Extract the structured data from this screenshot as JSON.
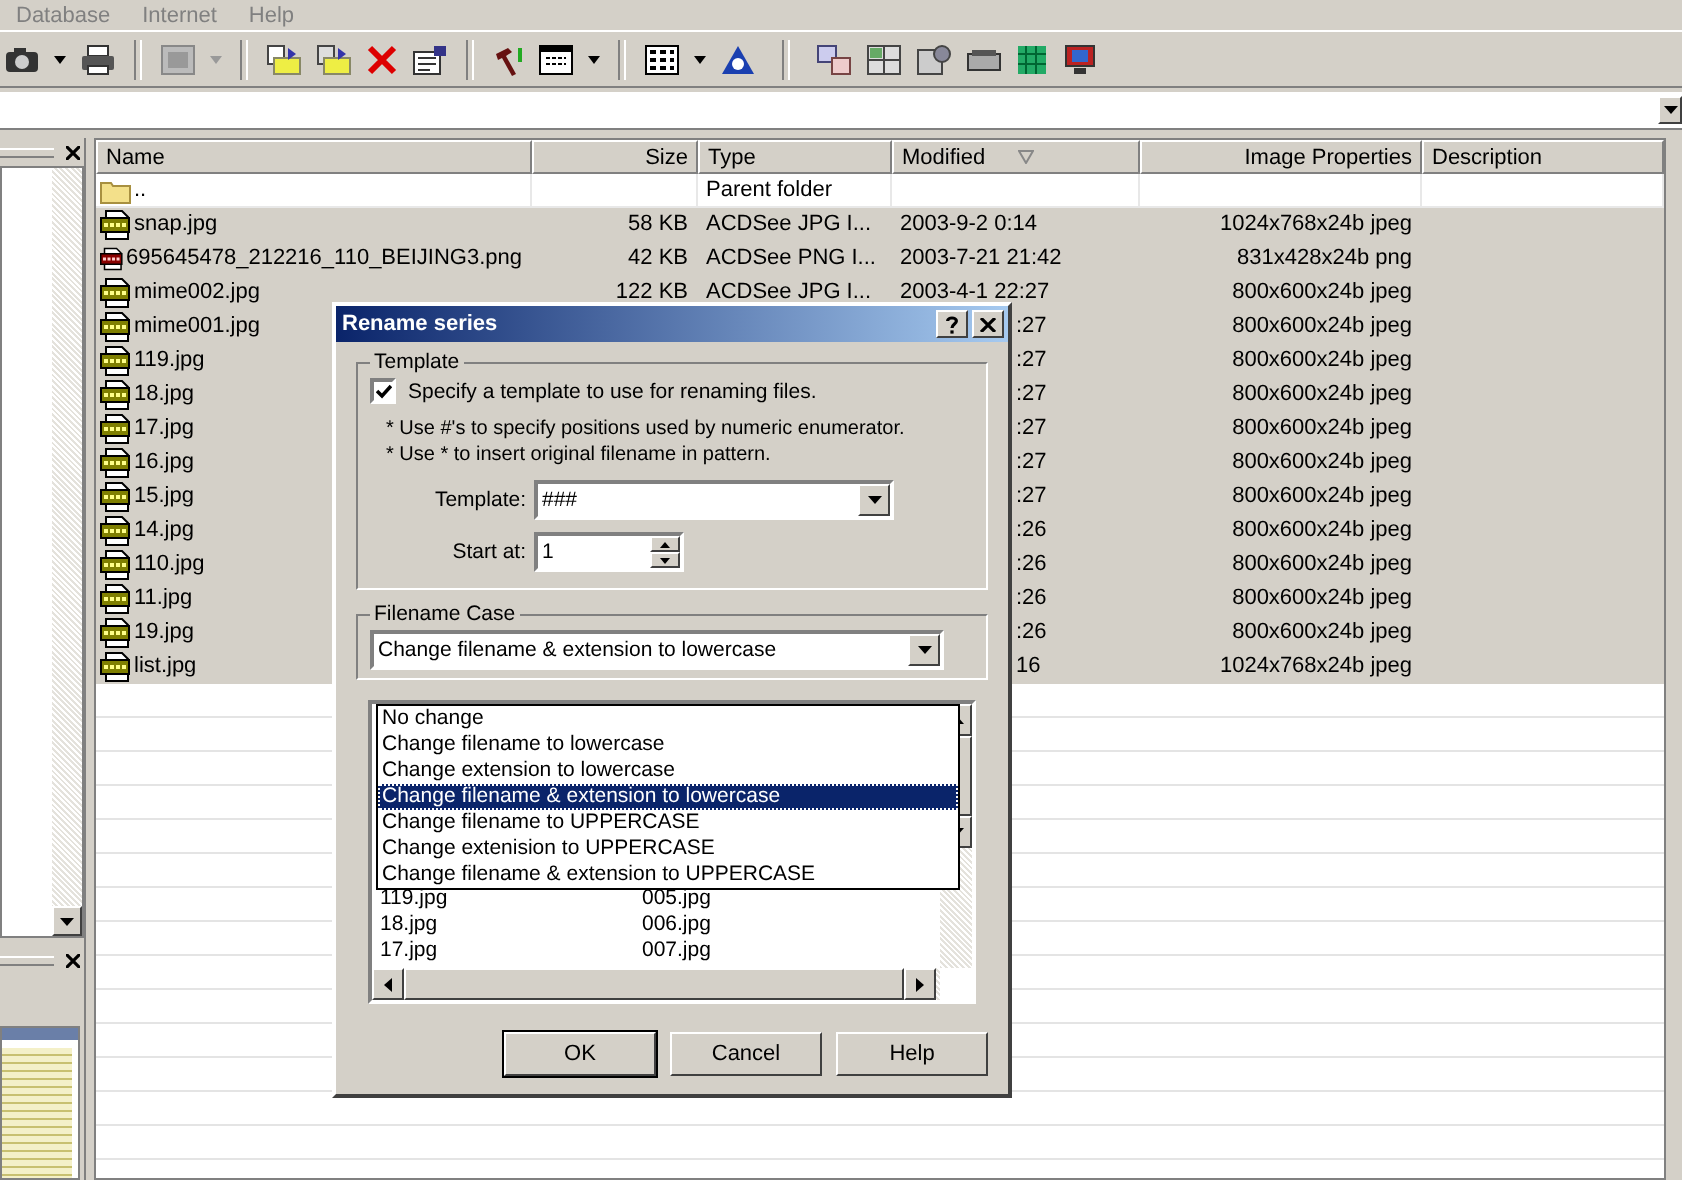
{
  "menu": [
    "Database",
    "Internet",
    "Help"
  ],
  "file_list": {
    "columns": [
      {
        "label": "Name",
        "sorted": false
      },
      {
        "label": "Size",
        "sorted": false
      },
      {
        "label": "Type",
        "sorted": false
      },
      {
        "label": "Modified",
        "sorted": true
      },
      {
        "label": "Image Properties",
        "sorted": false
      },
      {
        "label": "Description",
        "sorted": false
      }
    ],
    "rows": [
      {
        "kind": "folder",
        "name": "..",
        "size": "",
        "type": "Parent folder",
        "modified": "",
        "props": "",
        "selected": false
      },
      {
        "kind": "jpg",
        "name": "snap.jpg",
        "size": "58 KB",
        "type": "ACDSee JPG I...",
        "modified": "2003-9-2 0:14",
        "props": "1024x768x24b jpeg",
        "selected": true
      },
      {
        "kind": "png",
        "name": "695645478_212216_110_BEIJING3.png",
        "size": "42 KB",
        "type": "ACDSee PNG I...",
        "modified": "2003-7-21 21:42",
        "props": "831x428x24b png",
        "selected": true
      },
      {
        "kind": "jpg",
        "name": "mime002.jpg",
        "size": "122 KB",
        "type": "ACDSee JPG I...",
        "modified": "2003-4-1 22:27",
        "props": "800x600x24b jpeg",
        "selected": true
      },
      {
        "kind": "jpg",
        "name": "mime001.jpg",
        "size": "",
        "type": "",
        "modified": ":27",
        "props": "800x600x24b jpeg",
        "selected": true
      },
      {
        "kind": "jpg",
        "name": "119.jpg",
        "size": "",
        "type": "",
        "modified": ":27",
        "props": "800x600x24b jpeg",
        "selected": true
      },
      {
        "kind": "jpg",
        "name": "18.jpg",
        "size": "",
        "type": "",
        "modified": ":27",
        "props": "800x600x24b jpeg",
        "selected": true
      },
      {
        "kind": "jpg",
        "name": "17.jpg",
        "size": "",
        "type": "",
        "modified": ":27",
        "props": "800x600x24b jpeg",
        "selected": true
      },
      {
        "kind": "jpg",
        "name": "16.jpg",
        "size": "",
        "type": "",
        "modified": ":27",
        "props": "800x600x24b jpeg",
        "selected": true
      },
      {
        "kind": "jpg",
        "name": "15.jpg",
        "size": "",
        "type": "",
        "modified": ":27",
        "props": "800x600x24b jpeg",
        "selected": true
      },
      {
        "kind": "jpg",
        "name": "14.jpg",
        "size": "",
        "type": "",
        "modified": ":26",
        "props": "800x600x24b jpeg",
        "selected": true
      },
      {
        "kind": "jpg",
        "name": "110.jpg",
        "size": "",
        "type": "",
        "modified": ":26",
        "props": "800x600x24b jpeg",
        "selected": true
      },
      {
        "kind": "jpg",
        "name": "11.jpg",
        "size": "",
        "type": "",
        "modified": ":26",
        "props": "800x600x24b jpeg",
        "selected": true
      },
      {
        "kind": "jpg",
        "name": "19.jpg",
        "size": "",
        "type": "",
        "modified": ":26",
        "props": "800x600x24b jpeg",
        "selected": true
      },
      {
        "kind": "jpg",
        "name": "list.jpg",
        "size": "",
        "type": "",
        "modified": "16",
        "props": "1024x768x24b jpeg",
        "selected": true
      }
    ]
  },
  "dialog": {
    "title": "Rename series",
    "template_group": {
      "legend": "Template",
      "checkbox": {
        "label": "Specify a template to use for renaming files.",
        "checked": true
      },
      "hints": [
        "* Use #'s to specify positions used by numeric enumerator.",
        "* Use * to insert original filename in pattern."
      ],
      "template": {
        "label": "Template:",
        "value": "###"
      },
      "start_at": {
        "label": "Start at:",
        "value": "1"
      }
    },
    "case_group": {
      "legend": "Filename Case",
      "value": "Change filename & extension to lowercase",
      "options": [
        {
          "label": "No change",
          "selected": false
        },
        {
          "label": "Change filename to lowercase",
          "selected": false
        },
        {
          "label": "Change extension to lowercase",
          "selected": false
        },
        {
          "label": "Change filename & extension to lowercase",
          "selected": true
        },
        {
          "label": "Change filename to UPPERCASE",
          "selected": false
        },
        {
          "label": "Change extenision to UPPERCASE",
          "selected": false
        },
        {
          "label": "Change filename & extension to UPPERCASE",
          "selected": false
        }
      ]
    },
    "preview_rows": [
      {
        "original": "119.jpg",
        "renamed": "005.jpg"
      },
      {
        "original": "18.jpg",
        "renamed": "006.jpg"
      },
      {
        "original": "17.jpg",
        "renamed": "007.jpg"
      }
    ],
    "buttons": [
      "OK",
      "Cancel",
      "Help"
    ]
  }
}
